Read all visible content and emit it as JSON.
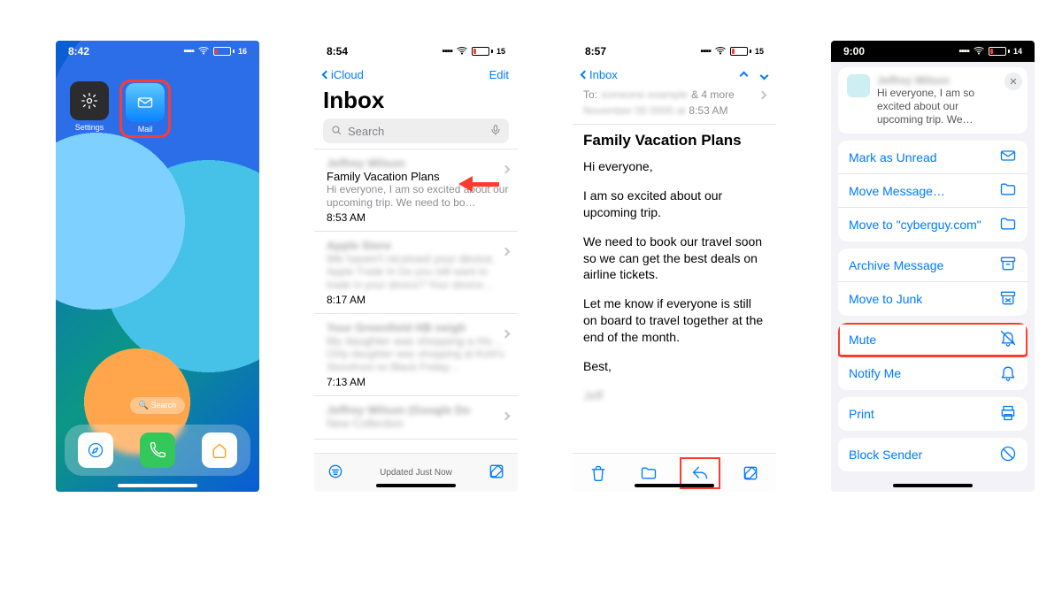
{
  "home": {
    "time": "8:42",
    "battery": "16",
    "settings_label": "Settings",
    "mail_label": "Mail",
    "search_pill": "Search"
  },
  "inbox": {
    "time": "8:54",
    "battery": "15",
    "back_label": "iCloud",
    "edit_label": "Edit",
    "title": "Inbox",
    "search_placeholder": "Search",
    "toolbar_status": "Updated Just Now",
    "messages": [
      {
        "sender": "Jeffrey Wilson",
        "subject": "Family Vacation Plans",
        "preview": "Hi everyone, I am so excited about our upcoming trip. We need to bo…",
        "time": "8:53 AM",
        "blur_sender": true
      },
      {
        "sender": "Apple Store",
        "subject": "We haven't received your device.",
        "preview": "Apple Trade In Do you still want to trade in your device? Your device…",
        "time": "8:17 AM",
        "blur_all": true
      },
      {
        "sender": "Your Greenfield HB neigh",
        "subject": "My daughter was shopping a Ho…",
        "preview": "Only daughter was shopping at Kohl's Storefront on Black Friday…",
        "time": "7:13 AM",
        "blur_all": true
      },
      {
        "sender": "Jeffrey Wilson (Google Do",
        "subject": "New Collection",
        "preview": "",
        "time": "",
        "blur_all": true
      }
    ]
  },
  "message": {
    "time": "8:57",
    "battery": "15",
    "back_label": "Inbox",
    "to_label": "To:",
    "to_more": "& 4 more",
    "date": "8:53 AM",
    "subject": "Family Vacation Plans",
    "paragraphs": [
      "Hi everyone,",
      "I am so excited about our upcoming trip.",
      "We need to book our travel soon so we can get the best deals on airline tickets.",
      "Let me know if everyone is still on board to travel together at the end of the month.",
      "Best,"
    ],
    "signature_blur": "Jeff"
  },
  "sheet": {
    "time": "9:00",
    "battery": "14",
    "preview_sender": "Jeffrey Wilson",
    "preview_text": "Hi everyone, I am so excited about our upcoming trip. We…",
    "items_a": [
      {
        "label": "Mark as Unread",
        "icon": "envelope"
      },
      {
        "label": "Move Message…",
        "icon": "folder"
      },
      {
        "label": "Move to \"cyberguy.com\"",
        "icon": "folder"
      }
    ],
    "items_b": [
      {
        "label": "Archive Message",
        "icon": "archive"
      },
      {
        "label": "Move to Junk",
        "icon": "junk"
      }
    ],
    "items_c": [
      {
        "label": "Mute",
        "icon": "bell-slash",
        "highlight": true
      },
      {
        "label": "Notify Me",
        "icon": "bell"
      }
    ],
    "items_d": [
      {
        "label": "Print",
        "icon": "print"
      }
    ],
    "items_e": [
      {
        "label": "Block Sender",
        "icon": "block"
      }
    ]
  }
}
